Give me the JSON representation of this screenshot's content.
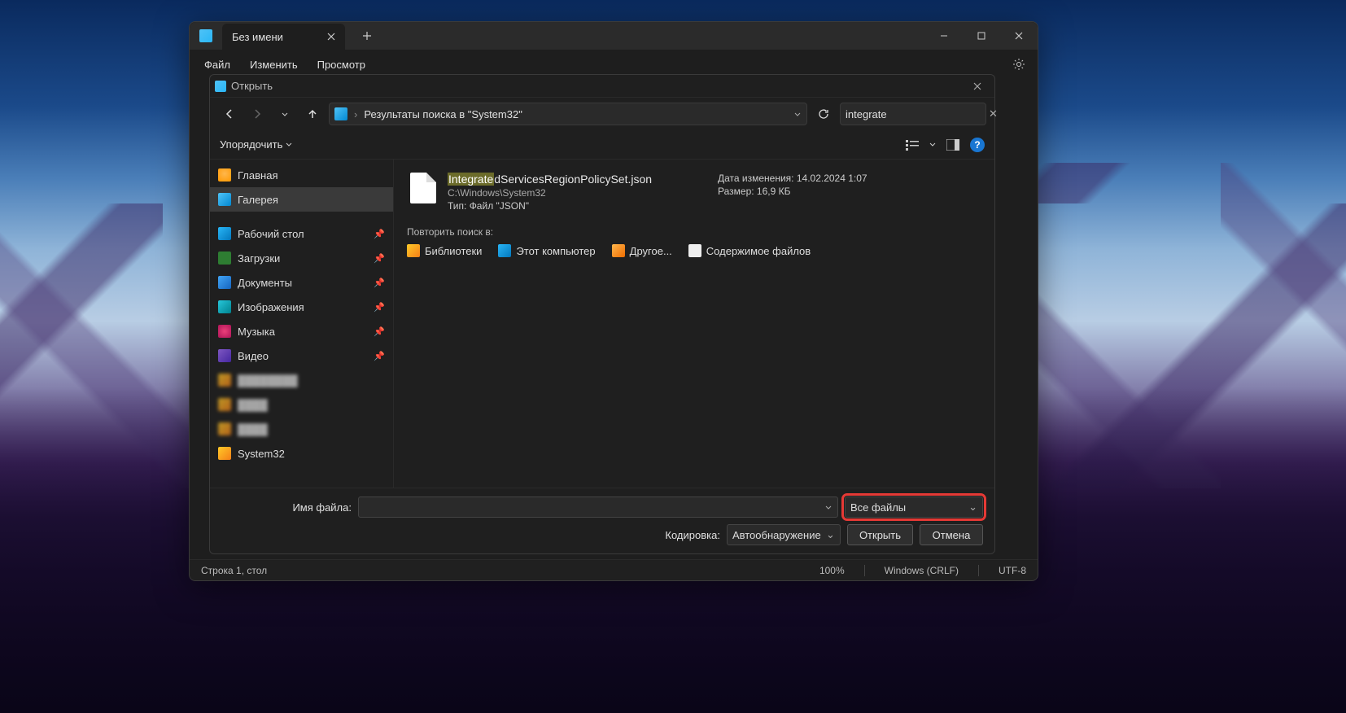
{
  "app": {
    "tab_title": "Без имени",
    "menu": {
      "file": "Файл",
      "edit": "Изменить",
      "view": "Просмотр"
    }
  },
  "dialog": {
    "title": "Открыть",
    "breadcrumb": "Результаты поиска в \"System32\"",
    "search_value": "integrate",
    "organize": "Упорядочить"
  },
  "sidebar": {
    "items": [
      {
        "label": "Главная",
        "icon": "home"
      },
      {
        "label": "Галерея",
        "icon": "gallery",
        "selected": true
      },
      {
        "label": "Рабочий стол",
        "icon": "desktop",
        "pinned": true
      },
      {
        "label": "Загрузки",
        "icon": "downloads",
        "pinned": true
      },
      {
        "label": "Документы",
        "icon": "docs",
        "pinned": true
      },
      {
        "label": "Изображения",
        "icon": "images",
        "pinned": true
      },
      {
        "label": "Музыка",
        "icon": "music",
        "pinned": true
      },
      {
        "label": "Видео",
        "icon": "video",
        "pinned": true
      },
      {
        "label": "System32",
        "icon": "folder"
      }
    ]
  },
  "result": {
    "name_pre": "Integrate",
    "name_rest": "dServicesRegionPolicySet.json",
    "path": "C:\\Windows\\System32",
    "date_label": "Дата изменения:",
    "date_value": "14.02.2024 1:07",
    "type_label": "Тип:",
    "type_value": "Файл \"JSON\"",
    "size_label": "Размер:",
    "size_value": "16,9 КБ"
  },
  "repeat": {
    "label": "Повторить поиск в:",
    "libraries": "Библиотеки",
    "thispc": "Этот компьютер",
    "other": "Другое...",
    "contents": "Содержимое файлов"
  },
  "bottom": {
    "filename_label": "Имя файла:",
    "filetype": "Все файлы",
    "encoding_label": "Кодировка:",
    "encoding_value": "Автообнаружение",
    "open": "Открыть",
    "cancel": "Отмена"
  },
  "status": {
    "line": "Строка 1, стол",
    "zoom": "100%",
    "eol": "Windows (CRLF)",
    "enc": "UTF-8"
  }
}
